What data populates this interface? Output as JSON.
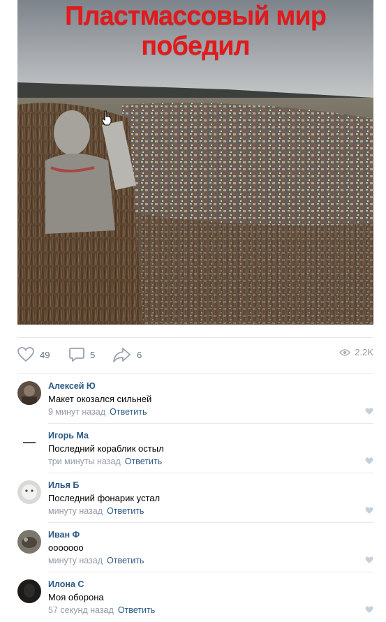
{
  "post": {
    "caption": "Пластмассовый мир победил",
    "likes": "49",
    "comments": "5",
    "shares": "6",
    "views": "2.2K"
  },
  "icons": {
    "like": "heart-icon",
    "comment": "comment-bubble-icon",
    "share": "share-arrow-icon",
    "views": "eye-icon",
    "cursor": "hand-pointer-icon"
  },
  "colors": {
    "caption": "#e3191c",
    "link": "#2a5885",
    "muted": "#939ba5",
    "icon": "#99a2ad"
  },
  "comments": [
    {
      "author": "Алексей Ю",
      "text": "Макет окозался сильней",
      "time": "9 минут назад",
      "reply": "Ответить"
    },
    {
      "author": "Игорь Ма",
      "text": "Последний кораблик остыл",
      "time": "три минуты назад",
      "reply": "Ответить"
    },
    {
      "author": "Илья Б",
      "text": "Последний фонарик устал",
      "time": "минуту назад",
      "reply": "Ответить"
    },
    {
      "author": "Иван Ф",
      "text": "ооооооо",
      "time": "минуту назад",
      "reply": "Ответить"
    },
    {
      "author": "Илона С",
      "text": "Моя оборона",
      "time": "57 секунд назад",
      "reply": "Ответить"
    }
  ]
}
